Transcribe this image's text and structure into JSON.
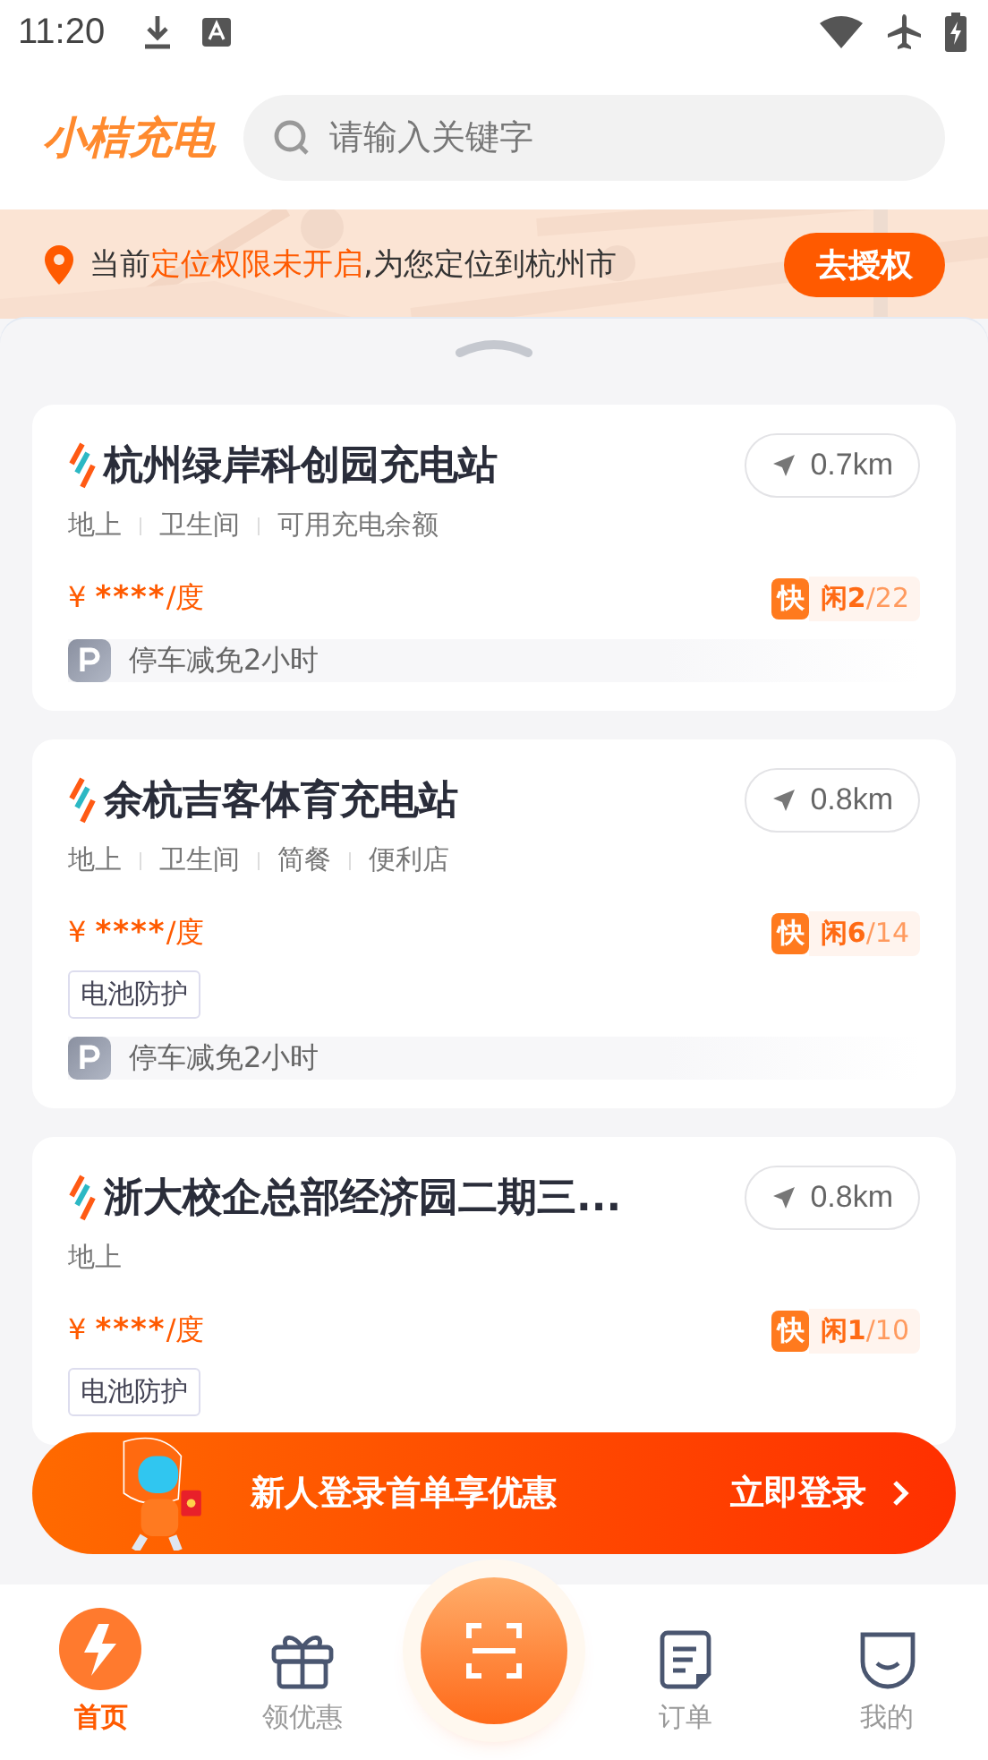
{
  "status_bar": {
    "time": "11:20"
  },
  "header": {
    "logo": "小桔充电",
    "search": {
      "placeholder": "请输入关键字"
    }
  },
  "location_notice": {
    "segments": [
      {
        "text": "当前",
        "highlight": false
      },
      {
        "text": "定位权限未开启",
        "highlight": true
      },
      {
        "text": ",为您定位到杭州市",
        "highlight": false
      }
    ],
    "button": "去授权"
  },
  "stations": [
    {
      "name": "杭州绿岸科创园充电站",
      "distance": "0.7km",
      "features": [
        "地上",
        "卫生间",
        "可用充电余额"
      ],
      "currency": "¥",
      "price": "****",
      "unit": "/度",
      "charger_type": "快",
      "idle": "闲2",
      "total": "/22",
      "parking": "停车减免2小时"
    },
    {
      "name": "余杭吉客体育充电站",
      "distance": "0.8km",
      "features": [
        "地上",
        "卫生间",
        "简餐",
        "便利店"
      ],
      "currency": "¥",
      "price": "****",
      "unit": "/度",
      "charger_type": "快",
      "idle": "闲6",
      "total": "/14",
      "tags": [
        "电池防护"
      ],
      "parking": "停车减免2小时"
    },
    {
      "name": "浙大校企总部经济园二期三...",
      "distance": "0.8km",
      "features": [
        "地上"
      ],
      "currency": "¥",
      "price": "****",
      "unit": "/度",
      "charger_type": "快",
      "idle": "闲1",
      "total": "/10",
      "tags": [
        "电池防护"
      ]
    }
  ],
  "promo": {
    "text": "新人登录首单享优惠",
    "action": "立即登录"
  },
  "bottom_nav": [
    {
      "kind": "home",
      "label": "首页",
      "selected": true
    },
    {
      "kind": "gift",
      "label": "领优惠",
      "selected": false
    },
    {
      "kind": "scan",
      "selected": false
    },
    {
      "kind": "order",
      "label": "订单",
      "selected": false
    },
    {
      "kind": "profile",
      "label": "我的",
      "selected": false
    }
  ]
}
